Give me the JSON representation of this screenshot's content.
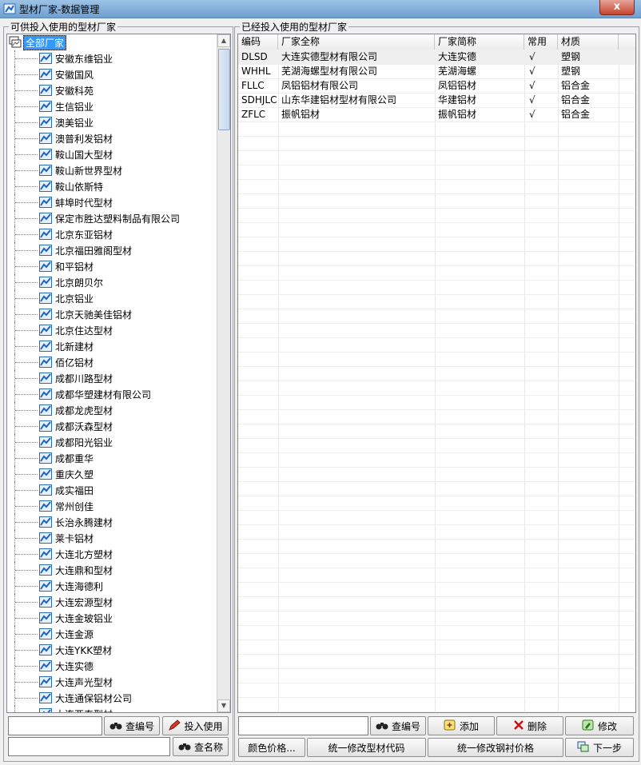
{
  "window": {
    "title": "型材厂家-数据管理",
    "close_label": "x"
  },
  "left_panel": {
    "legend": "可供投入使用的型材厂家",
    "root_label": "全部厂家",
    "items": [
      "安徽东维铝业",
      "安徽国风",
      "安徽科苑",
      "生信铝业",
      "澳美铝业",
      "澳普利发铝材",
      "鞍山国大型材",
      "鞍山新世界型材",
      "鞍山依斯特",
      "蚌埠时代型材",
      "保定市胜达塑料制品有限公司",
      "北京东亚铝材",
      "北京福田雅阁型材",
      "和平铝材",
      "北京朗贝尔",
      "北京铝业",
      "北京天驰美佳铝材",
      "北京住达型材",
      "北新建材",
      "佰亿铝材",
      "成都川路型材",
      "成都华塑建材有限公司",
      "成都龙虎型材",
      "成都沃森型材",
      "成都阳光铝业",
      "成都重华",
      "重庆久塑",
      "成实福田",
      "常州创佳",
      "长治永腾建材",
      "莱卡铝材",
      "大连北方塑材",
      "大连鼎和型材",
      "大连海德利",
      "大连宏源型材",
      "大连金玻铝业",
      "大连金源",
      "大连YKK塑材",
      "大连实德",
      "大连声光型材",
      "大连通保铝材公司",
      "大连亚泰型材"
    ],
    "search_code_button": "查编号",
    "use_button": "投入使用",
    "search_name_button": "查名称",
    "code_input_value": "",
    "name_input_value": ""
  },
  "right_panel": {
    "legend": "已经投入使用的型材厂家",
    "columns": [
      "编码",
      "厂家全称",
      "厂家简称",
      "常用",
      "材质"
    ],
    "rows": [
      [
        "DLSD",
        "大连实德型材有限公司",
        "大连实德",
        "√",
        "塑钢"
      ],
      [
        "WHHL",
        "芜湖海螺型材有限公司",
        "芜湖海螺",
        "√",
        "塑钢"
      ],
      [
        "FLLC",
        "凤铝铝材有限公司",
        "凤铝铝材",
        "√",
        "铝合金"
      ],
      [
        "SDHJLC",
        "山东华建铝材型材有限公司",
        "华建铝材",
        "√",
        "铝合金"
      ],
      [
        "ZFLC",
        "振帆铝材",
        "振帆铝材",
        "√",
        "铝合金"
      ]
    ],
    "search_input_value": "",
    "search_code_button": "查编号",
    "add_button": "添加",
    "delete_button": "删除",
    "edit_button": "修改",
    "color_price_button": "颜色价格...",
    "unify_code_button": "统一修改型材代码",
    "unify_price_button": "统一修改钢衬价格",
    "next_button": "下一步"
  },
  "colors": {
    "selection": "#3399ff",
    "title_bar": "#6f9fd1",
    "close": "#c7432e"
  }
}
